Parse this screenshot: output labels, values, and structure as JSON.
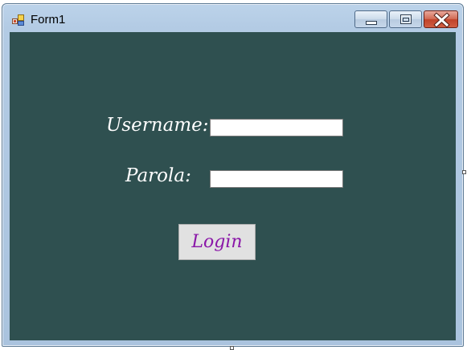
{
  "window": {
    "title": "Form1",
    "minimize_icon": "minimize-icon",
    "maximize_icon": "maximize-icon",
    "close_icon": "close-icon",
    "app_icon": "form-app-icon"
  },
  "form": {
    "background_color": "#2f5050",
    "username_label": "Username:",
    "username_value": "",
    "password_label": "Parola:",
    "password_value": "",
    "login_label": "Login",
    "label_color": "#ffffff",
    "login_text_color": "#8a16a8"
  }
}
